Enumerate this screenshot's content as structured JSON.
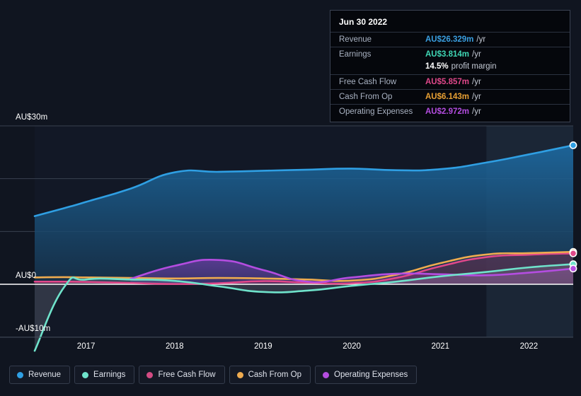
{
  "chart_data": {
    "type": "area",
    "title": "",
    "xlabel": "",
    "ylabel": "",
    "currency": "AU$",
    "units": "m",
    "ylim": [
      -13,
      30
    ],
    "xlim": [
      2016.42,
      2022.5
    ],
    "grid": true,
    "zero_line": true,
    "legend_position": "bottom",
    "y_ticks": [
      {
        "value": 30,
        "label": "AU$30m"
      },
      {
        "value": 0,
        "label": "AU$0"
      },
      {
        "value": -10,
        "label": "-AU$10m"
      }
    ],
    "x_ticks": [
      "2017",
      "2018",
      "2019",
      "2020",
      "2021",
      "2022"
    ],
    "x": [
      2016.42,
      2016.75,
      2017.0,
      2017.5,
      2018.0,
      2018.5,
      2019.0,
      2019.5,
      2020.0,
      2020.5,
      2021.0,
      2021.5,
      2022.0,
      2022.5
    ],
    "series": [
      {
        "name": "Revenue",
        "color": "#2f9fe3",
        "fill": true,
        "values": [
          12.9,
          14.4,
          15.6,
          18.1,
          21.2,
          21.3,
          21.5,
          21.7,
          21.9,
          21.6,
          21.8,
          23.0,
          24.6,
          26.329
        ]
      },
      {
        "name": "Earnings",
        "color": "#6fe3cb",
        "fill": false,
        "values": [
          -12.6,
          -0.6,
          0.9,
          0.9,
          0.65,
          -0.4,
          -1.45,
          -1.2,
          -0.3,
          0.5,
          1.5,
          2.3,
          3.2,
          3.814
        ]
      },
      {
        "name": "Free Cash Flow",
        "color": "#e0488a",
        "fill": false,
        "values": [
          0.5,
          0.5,
          0.45,
          0.25,
          0.05,
          0.2,
          0.6,
          0.3,
          0.2,
          1.2,
          3.4,
          5.1,
          5.6,
          5.857
        ]
      },
      {
        "name": "Cash From Op",
        "color": "#eeab4f",
        "fill": false,
        "values": [
          1.3,
          1.35,
          1.3,
          1.2,
          1.1,
          1.2,
          1.1,
          0.9,
          0.7,
          1.8,
          4.0,
          5.6,
          5.9,
          6.143
        ]
      },
      {
        "name": "Operating Expenses",
        "color": "#b44de0",
        "fill": true,
        "values": [
          null,
          null,
          null,
          1.0,
          3.5,
          4.6,
          2.7,
          0.5,
          1.3,
          2.0,
          1.9,
          1.7,
          2.2,
          2.972
        ]
      }
    ],
    "highlight_band": {
      "from": 2021.52,
      "to": 2022.5
    },
    "end_markers": [
      {
        "series": "Revenue",
        "value": 26.329
      },
      {
        "series": "Cash From Op",
        "value": 6.143
      },
      {
        "series": "Free Cash Flow",
        "value": 5.857
      },
      {
        "series": "Earnings",
        "value": 3.814
      },
      {
        "series": "Operating Expenses",
        "value": 2.972
      }
    ]
  },
  "tooltip": {
    "date": "Jun 30 2022",
    "rows": [
      {
        "key": "Revenue",
        "value": "AU$26.329m",
        "unit": "/yr",
        "color": "#3a9fe0"
      },
      {
        "key": "Earnings",
        "value": "AU$3.814m",
        "unit": "/yr",
        "color": "#3fd6b4"
      },
      {
        "key": "Free Cash Flow",
        "value": "AU$5.857m",
        "unit": "/yr",
        "color": "#e0488a"
      },
      {
        "key": "Cash From Op",
        "value": "AU$6.143m",
        "unit": "/yr",
        "color": "#e8a033"
      },
      {
        "key": "Operating Expenses",
        "value": "AU$2.972m",
        "unit": "/yr",
        "color": "#b44de0"
      }
    ],
    "margin_value": "14.5%",
    "margin_text": "profit margin"
  },
  "legend": {
    "items": [
      {
        "label": "Revenue",
        "color": "#2f9fe3"
      },
      {
        "label": "Earnings",
        "color": "#6fe3cb"
      },
      {
        "label": "Free Cash Flow",
        "color": "#d34b83"
      },
      {
        "label": "Cash From Op",
        "color": "#eeab4f"
      },
      {
        "label": "Operating Expenses",
        "color": "#b44de0"
      }
    ]
  },
  "axis": {
    "y_top": "AU$30m",
    "y_zero": "AU$0",
    "y_bottom": "-AU$10m",
    "x": [
      "2017",
      "2018",
      "2019",
      "2020",
      "2021",
      "2022"
    ]
  }
}
